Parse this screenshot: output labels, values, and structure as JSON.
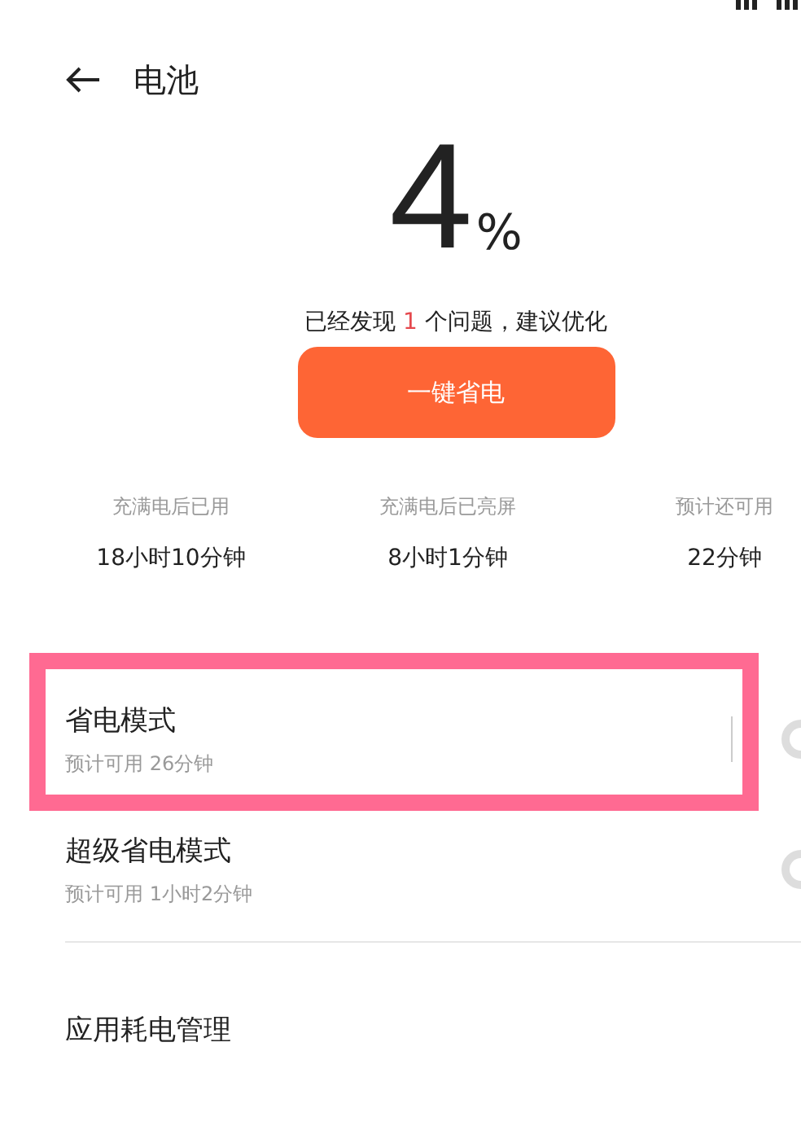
{
  "header": {
    "title": "电池"
  },
  "battery": {
    "percent": "4",
    "unit": "%"
  },
  "notice": {
    "before": "已经发现 ",
    "count": "1",
    "after": " 个问题，建议优化"
  },
  "action_button": "一键省电",
  "stats": [
    {
      "label": "充满电后已用",
      "value": "18小时10分钟"
    },
    {
      "label": "充满电后已亮屏",
      "value": "8小时1分钟"
    },
    {
      "label": "预计还可用",
      "value": "22分钟"
    }
  ],
  "modes": [
    {
      "title": "省电模式",
      "subtitle": "预计可用 26分钟",
      "on": false,
      "highlighted": true
    },
    {
      "title": "超级省电模式",
      "subtitle": "预计可用 1小时2分钟",
      "on": false,
      "highlighted": false
    }
  ],
  "menu": [
    {
      "title": "应用耗电管理"
    }
  ]
}
